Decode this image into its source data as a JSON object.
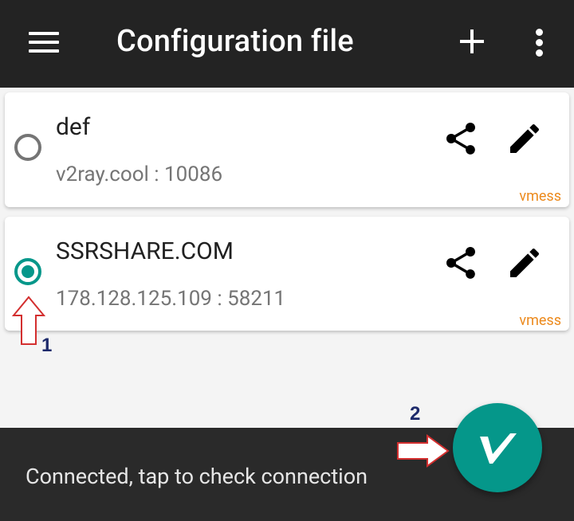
{
  "app_bar": {
    "title": "Configuration file",
    "icons": {
      "menu": "hamburger-menu-icon",
      "add": "plus-icon",
      "more": "more-vert-icon"
    }
  },
  "servers": [
    {
      "name": "def",
      "address": "v2ray.cool : 10086",
      "type": "vmess",
      "selected": false
    },
    {
      "name": "SSRSHARE.COM",
      "address": "178.128.125.109 : 58211",
      "type": "vmess",
      "selected": true
    }
  ],
  "annotations": {
    "marker_1": "1",
    "marker_2": "2"
  },
  "snackbar": {
    "message": "Connected, tap to check connection"
  },
  "fab": {
    "icon": "v2ray-logo-icon"
  },
  "colors": {
    "toolbar": "#232323",
    "accent": "#05978a",
    "protocol": "#ec8a1d",
    "annotation_arrow": "#d32f2f",
    "annotation_number": "#1d2a6b",
    "snackbar": "#2a2a2a"
  }
}
